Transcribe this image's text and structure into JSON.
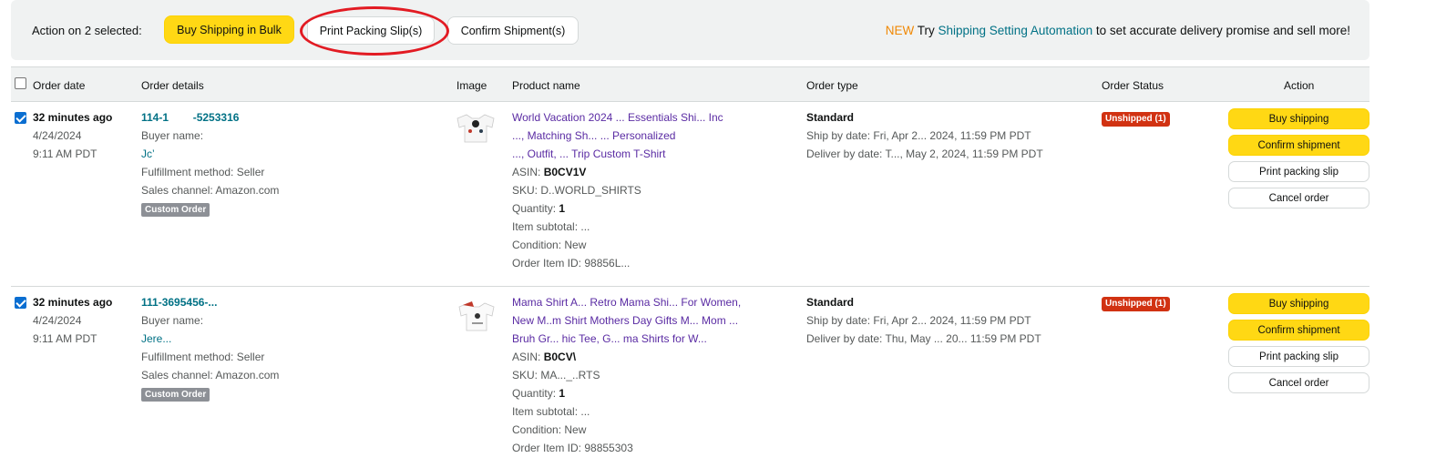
{
  "action_bar": {
    "label": "Action on 2 selected:",
    "buy_bulk": "Buy Shipping in Bulk",
    "print_slips": "Print Packing Slip(s)",
    "confirm_shipments": "Confirm Shipment(s)",
    "promo_new": "NEW",
    "promo_try": " Try ",
    "promo_link": "Shipping Setting Automation",
    "promo_tail": " to set accurate delivery promise and sell more!"
  },
  "table": {
    "headers": {
      "order_date": "Order date",
      "order_details": "Order details",
      "image": "Image",
      "product_name": "Product name",
      "order_type": "Order type",
      "order_status": "Order Status",
      "action": "Action"
    }
  },
  "orders": [
    {
      "age": "32 minutes ago",
      "date": "4/24/2024",
      "time": "9:11 AM PDT",
      "order_id": "114-1        -5253316",
      "buyer_label": "Buyer name:",
      "buyer_name": "Jc’",
      "fulfillment": "Fulfillment method: Seller",
      "channel": "Sales channel: Amazon.com",
      "badge": "Custom Order",
      "product_line1": "World Vacation 2024 ... Essentials Shi... Inc",
      "product_line2": "..., Matching Sh... ... Personalized",
      "product_line3": "..., Outfit, ... Trip Custom T-Shirt",
      "asin_label": "ASIN: ",
      "asin": "B0CV1V",
      "sku": "SKU: D..WORLD_SHIRTS",
      "qty_label": "Quantity: ",
      "qty": "1",
      "subtotal": "Item subtotal: ...",
      "condition": "Condition: New",
      "item_id": "Order Item ID: 98856L...",
      "order_type": "Standard",
      "ship_by": "Ship by date: Fri, Apr 2... 2024, 11:59 PM PDT",
      "deliver_by": "Deliver by date: T..., May 2, 2024, 11:59 PM PDT",
      "status": "Unshipped (1)",
      "btn_buy": "Buy shipping",
      "btn_confirm": "Confirm shipment",
      "btn_print": "Print packing slip",
      "btn_cancel": "Cancel order"
    },
    {
      "age": "32 minutes ago",
      "date": "4/24/2024",
      "time": "9:11 AM PDT",
      "order_id": "111-3695456-...",
      "buyer_label": "Buyer name:",
      "buyer_name": "Jere...",
      "fulfillment": "Fulfillment method: Seller",
      "channel": "Sales channel: Amazon.com",
      "badge": "Custom Order",
      "product_line1": "Mama Shirt A... Retro Mama Shi... For Women,",
      "product_line2": "New M..m Shirt Mothers Day Gifts M... Mom ...",
      "product_line3": "Bruh Gr... hic Tee, G... ma Shirts for W...",
      "asin_label": "ASIN: ",
      "asin": "B0CV\\",
      "sku": "SKU: MA..._..RTS",
      "qty_label": "Quantity: ",
      "qty": "1",
      "subtotal": "Item subtotal: ...",
      "condition": "Condition: New",
      "item_id": "Order Item ID: 98855303",
      "order_type": "Standard",
      "ship_by": "Ship by date: Fri, Apr 2... 2024, 11:59 PM PDT",
      "deliver_by": "Deliver by date: Thu, May ... 20... 11:59 PM PDT",
      "status": "Unshipped (1)",
      "btn_buy": "Buy shipping",
      "btn_confirm": "Confirm shipment",
      "btn_print": "Print packing slip",
      "btn_cancel": "Cancel order"
    }
  ],
  "colors": {
    "accent_yellow": "#ffd814",
    "link_teal": "#007185",
    "new_orange": "#f08804",
    "status_red": "#d13212",
    "annotation_red": "#e21b23"
  }
}
